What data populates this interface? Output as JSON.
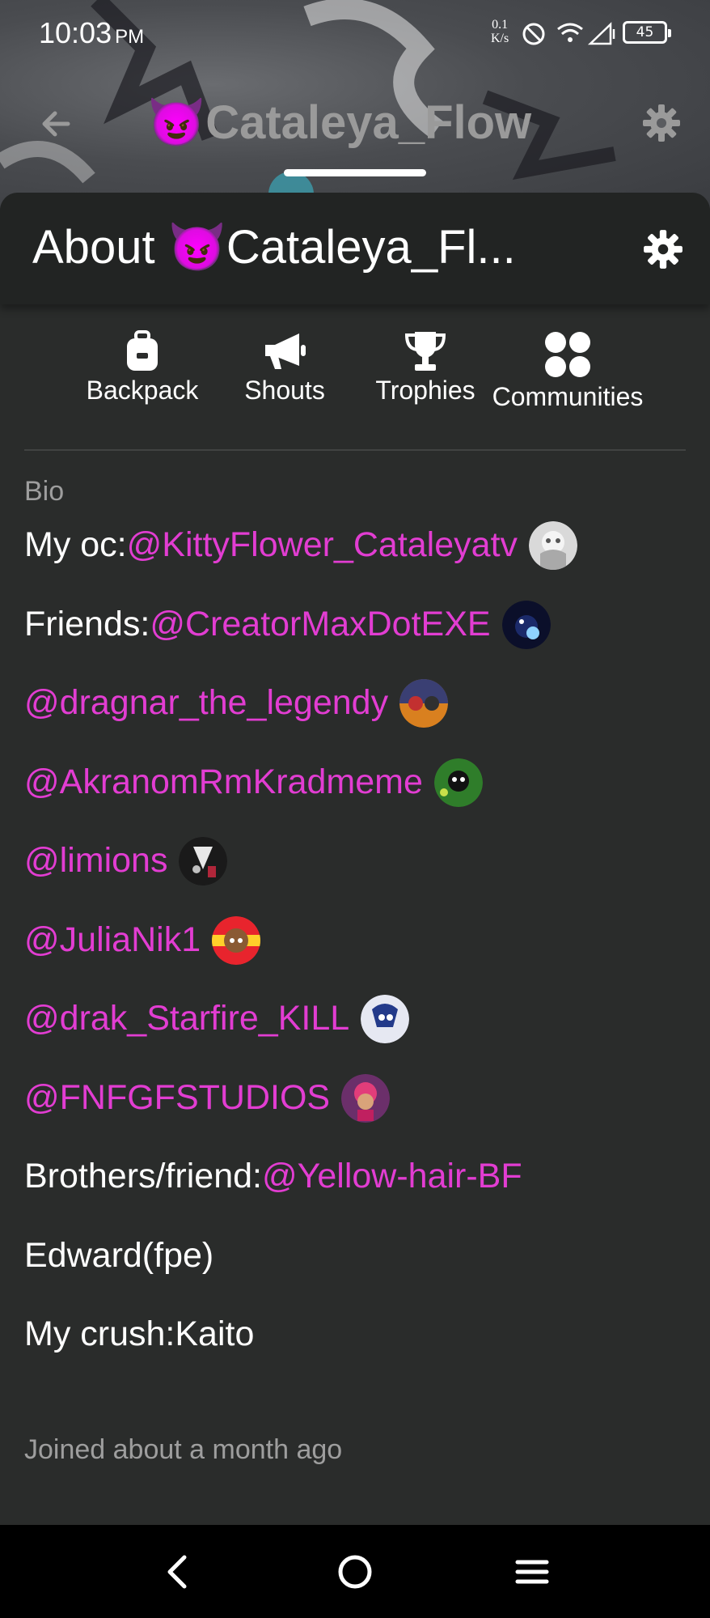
{
  "status_bar": {
    "time": "10:03",
    "ampm": "PM",
    "net_speed_value": "0.1",
    "net_speed_unit": "K/s",
    "battery": "45"
  },
  "app_bar": {
    "title": "😈Cataleya_Flow"
  },
  "sheet": {
    "title": "About 😈Cataleya_Fl..."
  },
  "tabs": [
    {
      "label": "Backpack",
      "icon": "backpack-icon"
    },
    {
      "label": "Shouts",
      "icon": "megaphone-icon"
    },
    {
      "label": "Trophies",
      "icon": "trophy-icon"
    },
    {
      "label": "Communities",
      "icon": "communities-icon"
    }
  ],
  "bio": {
    "label": "Bio",
    "lines": [
      {
        "prefix": "My oc:",
        "mention": "@KittyFlower_Cataleyatv",
        "avatar": true
      },
      {
        "prefix": "Friends:",
        "mention": "@CreatorMaxDotEXE",
        "avatar": true
      },
      {
        "prefix": "",
        "mention": "@dragnar_the_legendy",
        "avatar": true
      },
      {
        "prefix": "",
        "mention": "@AkranomRmKradmeme",
        "avatar": true
      },
      {
        "prefix": "",
        "mention": "@limions",
        "avatar": true
      },
      {
        "prefix": "",
        "mention": "@JuliaNik1",
        "avatar": true
      },
      {
        "prefix": "",
        "mention": "@drak_Starfire_KILL",
        "avatar": true
      },
      {
        "prefix": "",
        "mention": "@FNFGFSTUDIOS",
        "avatar": true
      },
      {
        "prefix": "Brothers/friend:",
        "mention": "@Yellow-hair-BF",
        "avatar": false
      },
      {
        "prefix": "Edward(fpe)",
        "mention": "",
        "avatar": false
      },
      {
        "prefix": "My crush:Kaito",
        "mention": "",
        "avatar": false
      }
    ]
  },
  "joined": "Joined about a month ago",
  "colors": {
    "mention": "#e23dd2",
    "background": "#2a2c2b",
    "header": "#222423",
    "muted": "#9e9e9e"
  }
}
